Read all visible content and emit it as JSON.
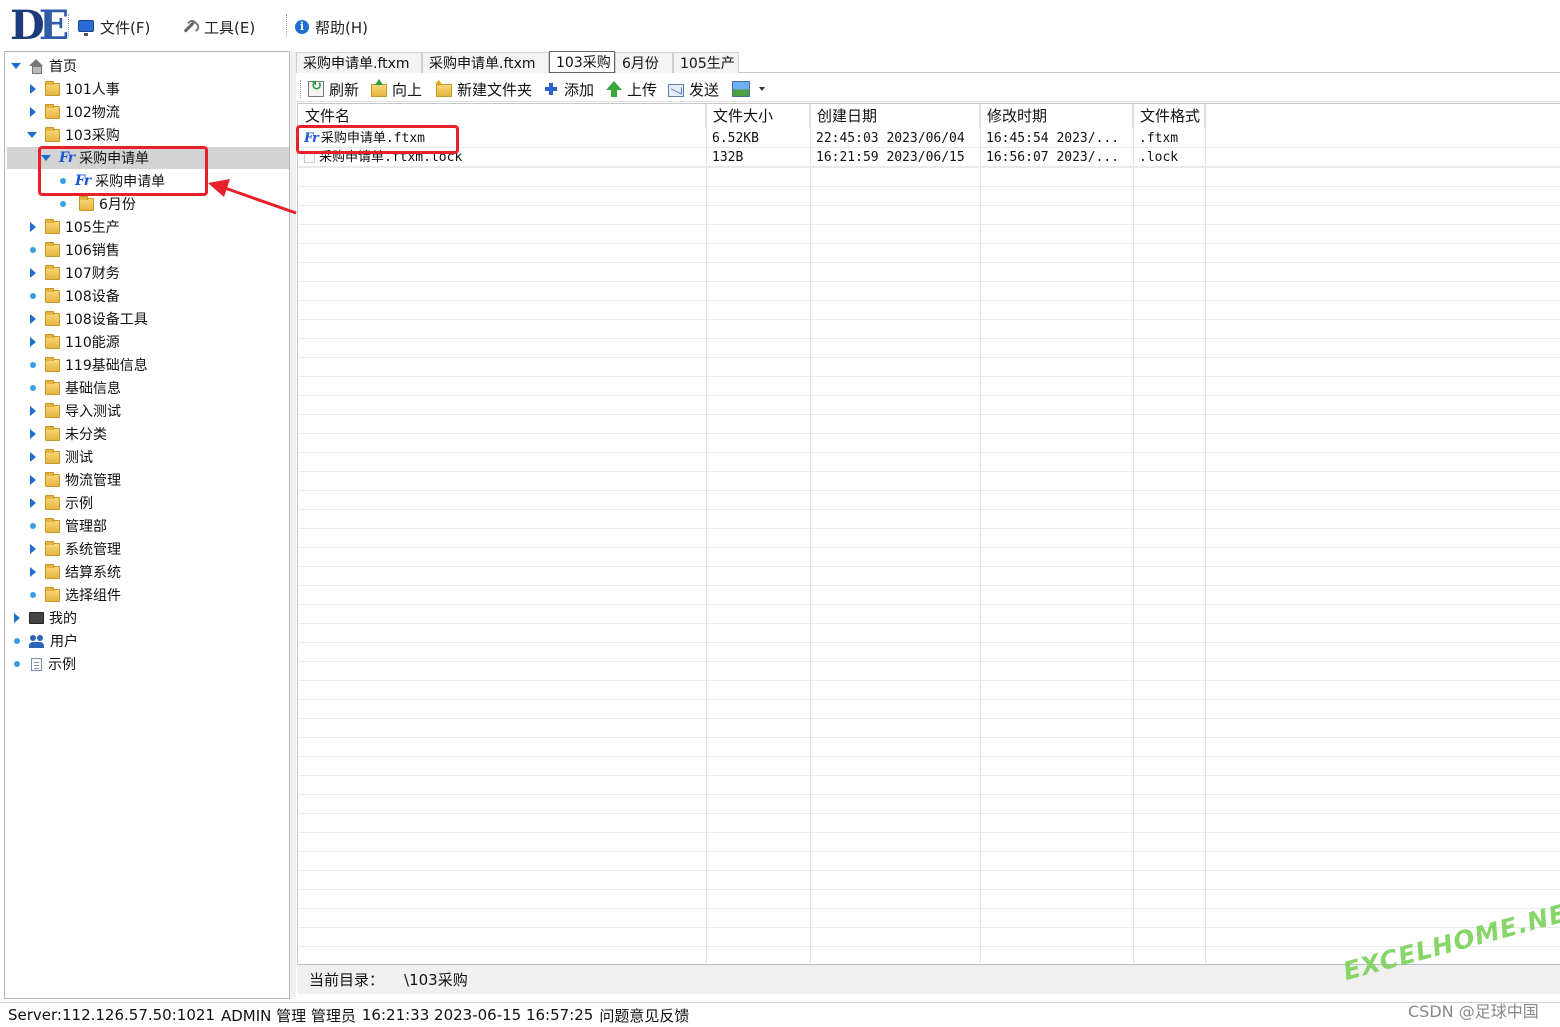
{
  "menubar": {
    "logo_d": "D",
    "logo_e": "E",
    "file": "文件(F)",
    "tools": "工具(E)",
    "help": "帮助(H)"
  },
  "tree": {
    "home": "首页",
    "items": [
      {
        "label": "101人事"
      },
      {
        "label": "102物流"
      },
      {
        "label": "103采购"
      },
      {
        "label": "采购申请单"
      },
      {
        "label": "采购申请单"
      },
      {
        "label": "6月份"
      },
      {
        "label": "105生产"
      },
      {
        "label": "106销售"
      },
      {
        "label": "107财务"
      },
      {
        "label": "108设备"
      },
      {
        "label": "108设备工具"
      },
      {
        "label": "110能源"
      },
      {
        "label": "119基础信息"
      },
      {
        "label": "基础信息"
      },
      {
        "label": "导入测试"
      },
      {
        "label": "未分类"
      },
      {
        "label": "测试"
      },
      {
        "label": "物流管理"
      },
      {
        "label": "示例"
      },
      {
        "label": "管理部"
      },
      {
        "label": "系统管理"
      },
      {
        "label": "结算系统"
      },
      {
        "label": "选择组件"
      }
    ],
    "mine": "我的",
    "users": "用户",
    "examples": "示例"
  },
  "tabs": [
    {
      "label": "采购申请单.ftxm"
    },
    {
      "label": "采购申请单.ftxm"
    },
    {
      "label": "103采购"
    },
    {
      "label": "6月份"
    },
    {
      "label": "105生产"
    }
  ],
  "toolbar": {
    "refresh": "刷新",
    "up": "向上",
    "new_folder": "新建文件夹",
    "add": "添加",
    "upload": "上传",
    "send": "发送"
  },
  "grid": {
    "columns": [
      "文件名",
      "文件大小",
      "创建日期",
      "修改时期",
      "文件格式"
    ],
    "rows": [
      {
        "name": "采购申请单.ftxm",
        "size": "6.52KB",
        "created": "22:45:03 2023/06/04",
        "modified": "16:45:54 2023/...",
        "format": ".ftxm"
      },
      {
        "name": "采购申请单.ftxm.lock",
        "size": "132B",
        "created": "16:21:59 2023/06/15",
        "modified": "16:56:07 2023/...",
        "format": ".lock"
      }
    ]
  },
  "curdir": {
    "label": "当前目录：",
    "path": "\\103采购"
  },
  "status": {
    "server": "Server:112.126.57.50:1021",
    "user": "ADMIN 管理 管理员",
    "times": "16:21:33 2023-06-15 16:57:25",
    "feedback": "问题意见反馈"
  },
  "watermark": {
    "site": "EXCELHOME.NET",
    "credit": "CSDN @足球中国"
  },
  "colors": {
    "accent": "#1a6fd0",
    "annotation": "#e8202a",
    "selected_row": "#d3d3d3"
  }
}
